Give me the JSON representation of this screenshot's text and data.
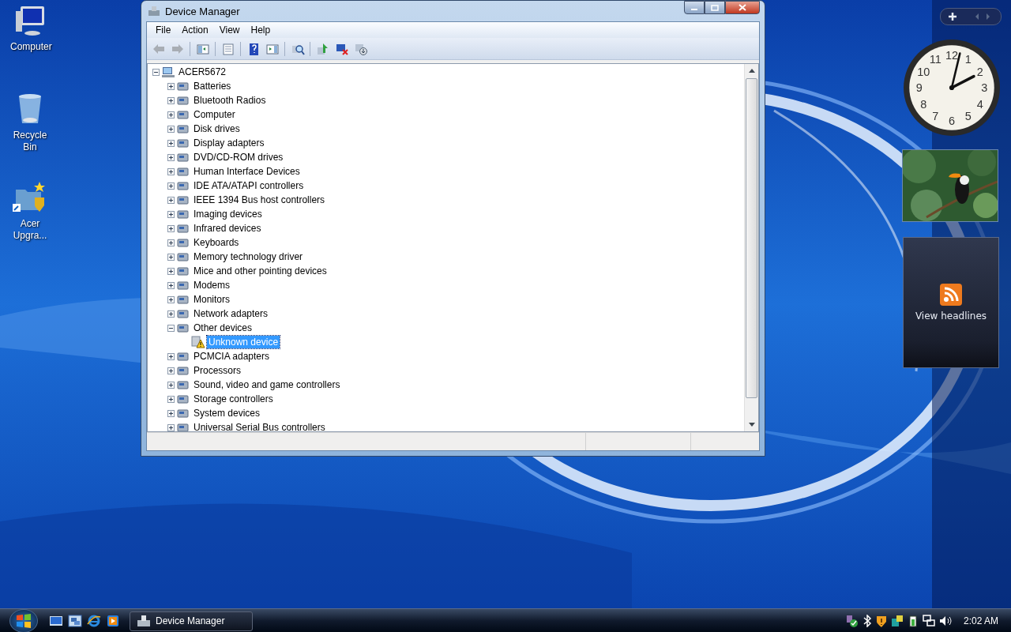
{
  "desktop_icons": [
    {
      "kind": "computer",
      "label": "Computer"
    },
    {
      "kind": "recycle",
      "label": "Recycle Bin"
    },
    {
      "kind": "shortcut",
      "label": "Acer Upgra..."
    }
  ],
  "window": {
    "title": "Device Manager",
    "menu": [
      "File",
      "Action",
      "View",
      "Help"
    ],
    "toolbar": [
      {
        "kind": "back",
        "disabled": true
      },
      {
        "kind": "forward",
        "disabled": true
      },
      {
        "kind": "sep"
      },
      {
        "kind": "tree"
      },
      {
        "kind": "sep"
      },
      {
        "kind": "properties"
      },
      {
        "kind": "sep"
      },
      {
        "kind": "help"
      },
      {
        "kind": "pane"
      },
      {
        "kind": "sep"
      },
      {
        "kind": "scan"
      },
      {
        "kind": "sep"
      },
      {
        "kind": "update"
      },
      {
        "kind": "uninstall"
      },
      {
        "kind": "disable"
      }
    ],
    "tree": {
      "label": "ACER5672",
      "expanded": true,
      "selected": false,
      "children": [
        {
          "label": "Batteries",
          "expanded": false,
          "selected": false
        },
        {
          "label": "Bluetooth Radios",
          "expanded": false,
          "selected": false
        },
        {
          "label": "Computer",
          "expanded": false,
          "selected": false
        },
        {
          "label": "Disk drives",
          "expanded": false,
          "selected": false
        },
        {
          "label": "Display adapters",
          "expanded": false,
          "selected": false
        },
        {
          "label": "DVD/CD-ROM drives",
          "expanded": false,
          "selected": false
        },
        {
          "label": "Human Interface Devices",
          "expanded": false,
          "selected": false
        },
        {
          "label": "IDE ATA/ATAPI controllers",
          "expanded": false,
          "selected": false
        },
        {
          "label": "IEEE 1394 Bus host controllers",
          "expanded": false,
          "selected": false
        },
        {
          "label": "Imaging devices",
          "expanded": false,
          "selected": false
        },
        {
          "label": "Infrared devices",
          "expanded": false,
          "selected": false
        },
        {
          "label": "Keyboards",
          "expanded": false,
          "selected": false
        },
        {
          "label": "Memory technology driver",
          "expanded": false,
          "selected": false
        },
        {
          "label": "Mice and other pointing devices",
          "expanded": false,
          "selected": false
        },
        {
          "label": "Modems",
          "expanded": false,
          "selected": false
        },
        {
          "label": "Monitors",
          "expanded": false,
          "selected": false
        },
        {
          "label": "Network adapters",
          "expanded": false,
          "selected": false
        },
        {
          "label": "Other devices",
          "expanded": true,
          "selected": false,
          "children": [
            {
              "label": "Unknown device",
              "kind": "warning",
              "selected": true
            }
          ]
        },
        {
          "label": "PCMCIA adapters",
          "expanded": false,
          "selected": false
        },
        {
          "label": "Processors",
          "expanded": false,
          "selected": false
        },
        {
          "label": "Sound, video and game controllers",
          "expanded": false,
          "selected": false
        },
        {
          "label": "Storage controllers",
          "expanded": false,
          "selected": false
        },
        {
          "label": "System devices",
          "expanded": false,
          "selected": false
        },
        {
          "label": "Universal Serial Bus controllers",
          "expanded": false,
          "selected": false
        }
      ]
    }
  },
  "sidebar": {
    "clock_numerals": [
      "12",
      "11",
      "1",
      "10",
      "2",
      "9",
      "3",
      "8",
      "4",
      "7",
      "5",
      "6"
    ],
    "feed": {
      "label": "View headlines"
    }
  },
  "taskbar": {
    "quick_launch": [
      {
        "kind": "desktop"
      },
      {
        "kind": "switch"
      },
      {
        "kind": "browser"
      },
      {
        "kind": "media"
      }
    ],
    "tasks": [
      {
        "label": "Device Manager",
        "selected": false
      }
    ],
    "tray": [
      {
        "kind": "network"
      },
      {
        "kind": "bluetooth"
      },
      {
        "kind": "security"
      },
      {
        "kind": "sync"
      },
      {
        "kind": "power"
      },
      {
        "kind": "lan"
      },
      {
        "kind": "volume"
      }
    ],
    "time": "2:02 AM"
  }
}
